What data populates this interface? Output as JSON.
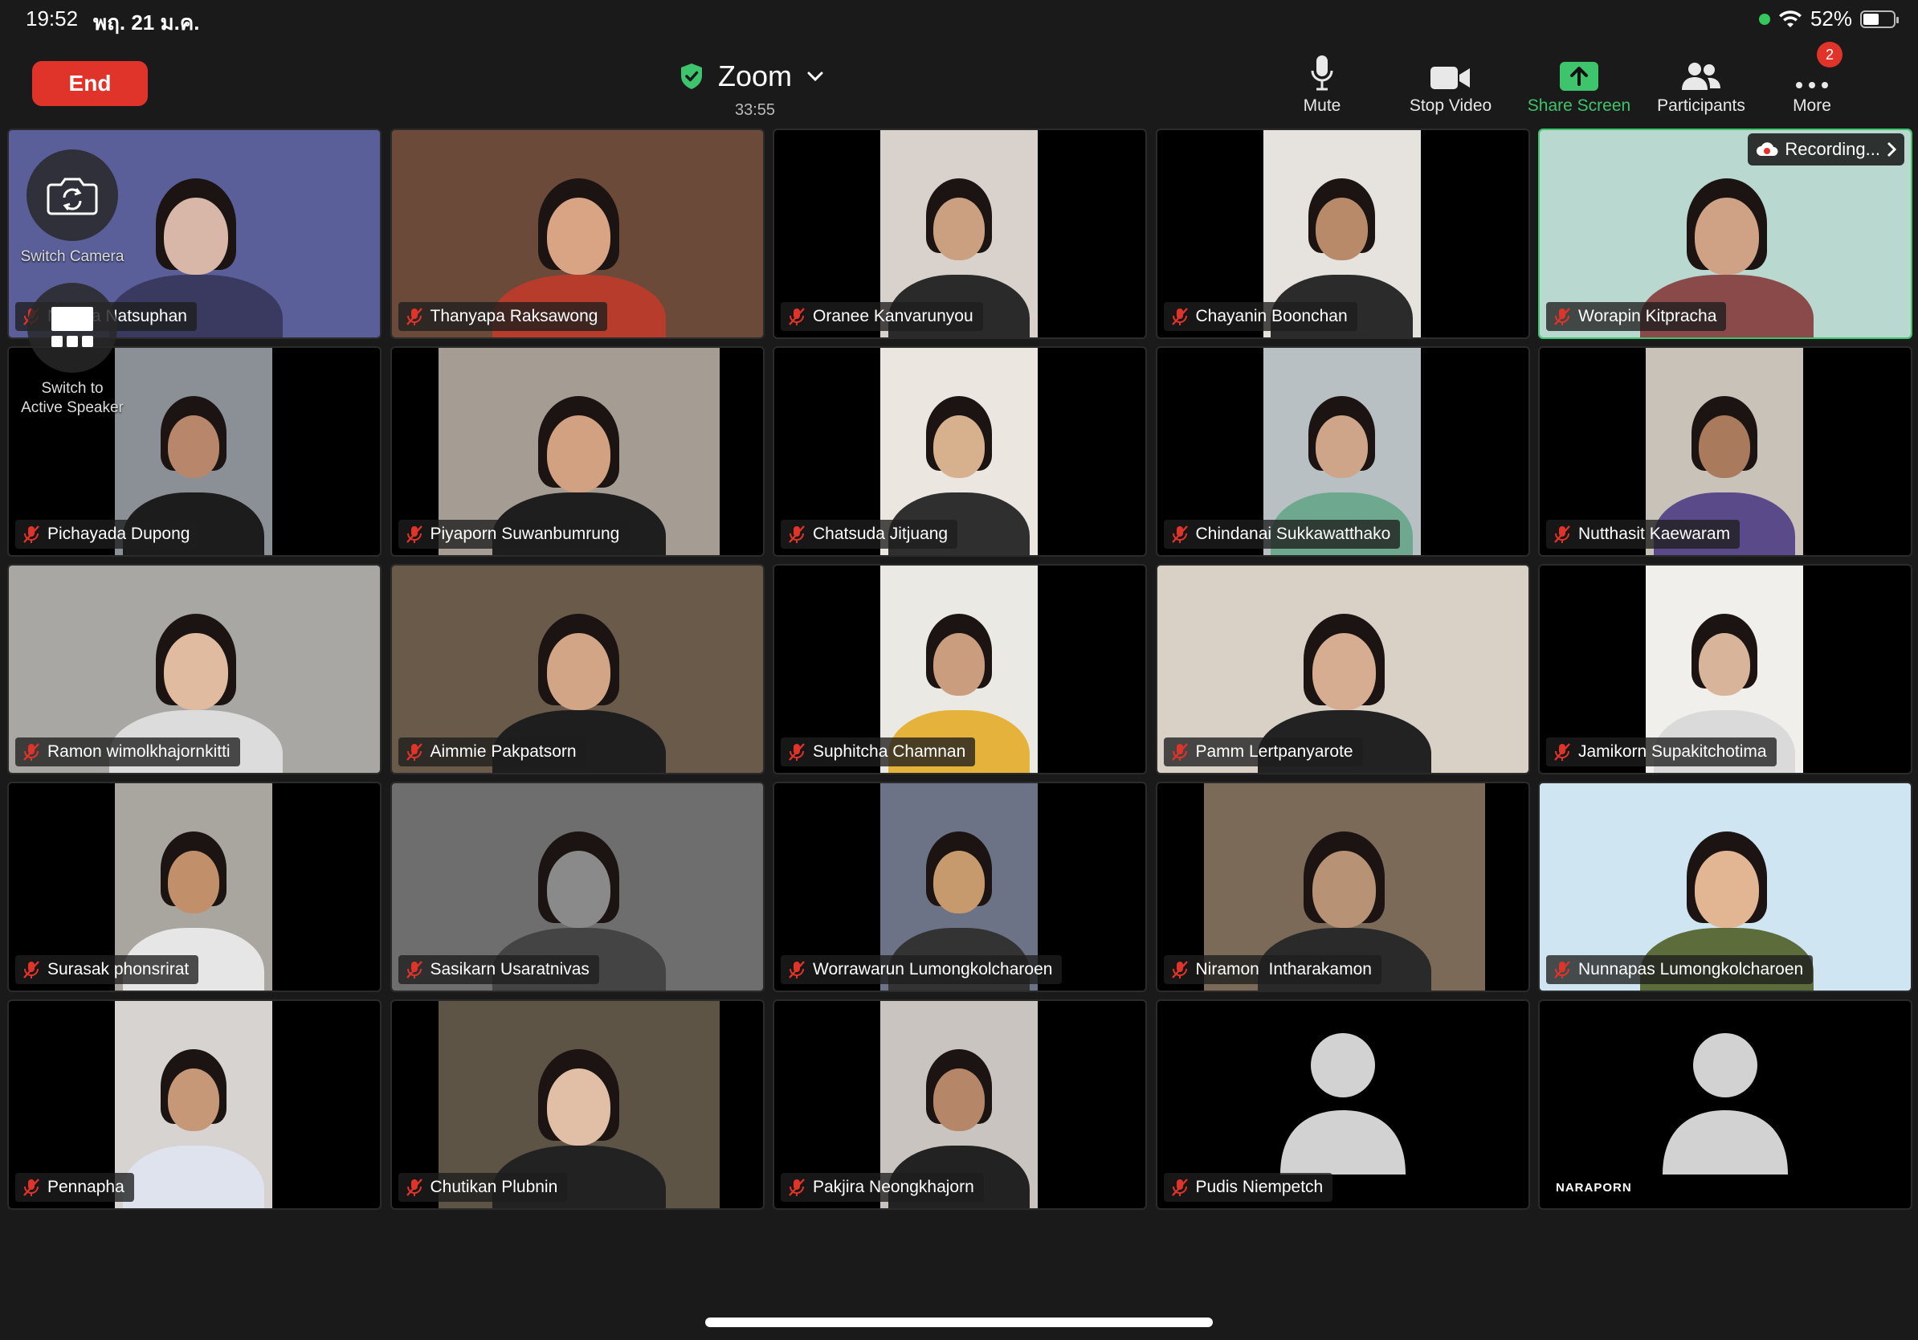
{
  "status_bar": {
    "time": "19:52",
    "date": "พฤ. 21 ม.ค.",
    "battery": "52%",
    "battery_level": 0.52
  },
  "header": {
    "end_label": "End",
    "title": "Zoom",
    "timer": "33:55"
  },
  "toolbar": {
    "mute_label": "Mute",
    "stop_video_label": "Stop Video",
    "share_screen_label": "Share Screen",
    "participants_label": "Participants",
    "more_label": "More",
    "more_badge": "2"
  },
  "overlays": {
    "switch_camera_label": "Switch Camera",
    "switch_speaker_line1": "Switch to",
    "switch_speaker_line2": "Active Speaker",
    "recording_label": "Recording..."
  },
  "participants": [
    {
      "name": "Natsuphan",
      "display": "N     ya Natsuphan"
    },
    {
      "name": "Thanyapa Raksawong"
    },
    {
      "name": "Oranee Kanvarunyou"
    },
    {
      "name": "Chayanin Boonchan"
    },
    {
      "name": "Worapin Kitpracha"
    },
    {
      "name": "Pichayada Dupong"
    },
    {
      "name": "Piyaporn Suwanbumrung"
    },
    {
      "name": "Chatsuda Jitjuang"
    },
    {
      "name": "Chindanai Sukkawatthako"
    },
    {
      "name": "Nutthasit Kaewaram"
    },
    {
      "name": "Ramon wimolkhajornkitti"
    },
    {
      "name": "Aimmie Pakpatsorn"
    },
    {
      "name": "Suphitcha Chamnan"
    },
    {
      "name": "Pamm Lertpanyarote"
    },
    {
      "name": "Jamikorn Supakitchotima"
    },
    {
      "name": "Surasak phonsrirat"
    },
    {
      "name": "Sasikarn Usaratnivas"
    },
    {
      "name": "Worrawarun Lumongkolcharoen"
    },
    {
      "name": "Niramon  Intharakamon"
    },
    {
      "name": "Nunnapas Lumongkolcharoen"
    },
    {
      "name": "Pennapha"
    },
    {
      "name": "Chutikan Plubnin"
    },
    {
      "name": "Pakjira Neongkhajorn"
    },
    {
      "name": "Pudis Niempetch"
    },
    {
      "name": "NARAPORN"
    }
  ],
  "colors": {
    "end_button": "#e0342a",
    "share_green": "#3ec46d",
    "muted_red": "#e0342a",
    "background": "#1a1a1a"
  }
}
